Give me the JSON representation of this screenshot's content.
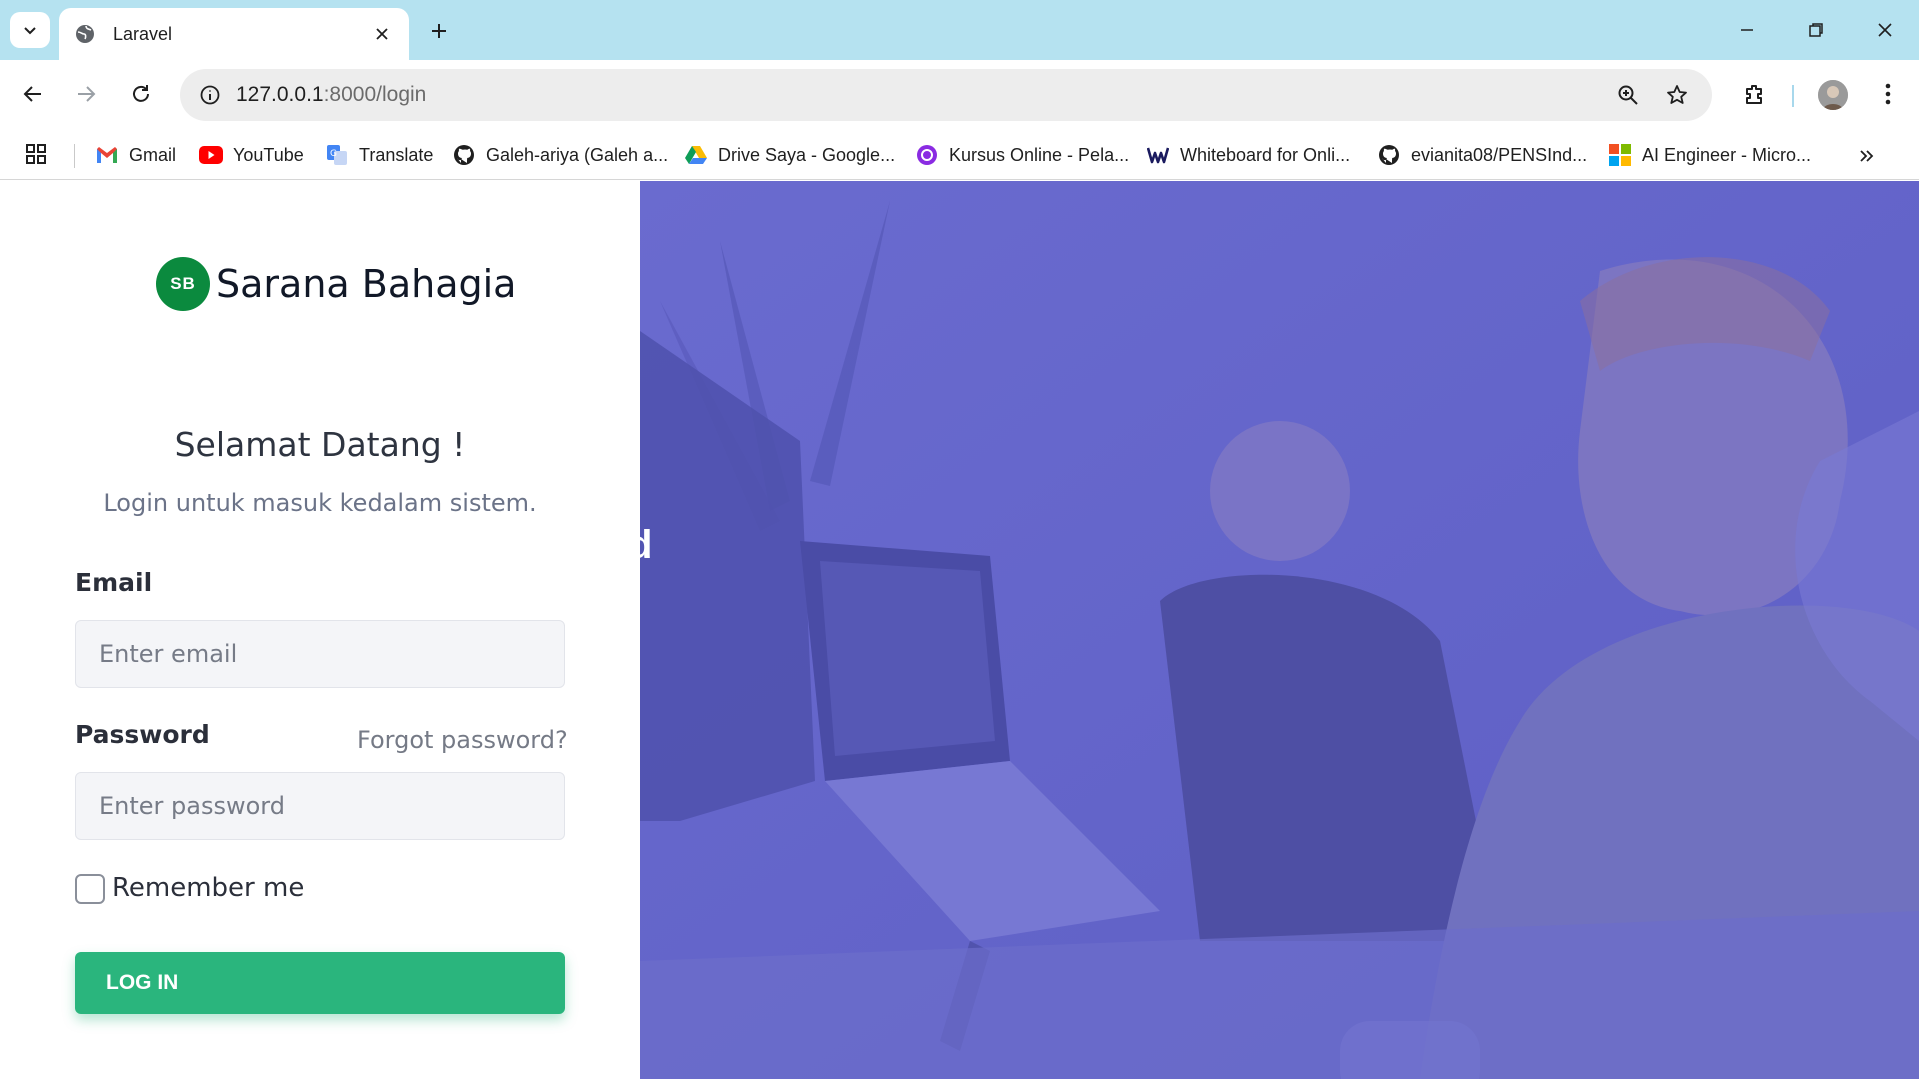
{
  "browser": {
    "tab_title": "Laravel",
    "url_host": "127.0.0.1",
    "url_rest": ":8000/login",
    "bookmarks": [
      {
        "label": "Gmail",
        "icon": "gmail-icon"
      },
      {
        "label": "YouTube",
        "icon": "youtube-icon"
      },
      {
        "label": "Translate",
        "icon": "translate-icon"
      },
      {
        "label": "Galeh-ariya (Galeh a...",
        "icon": "github-icon"
      },
      {
        "label": "Drive Saya - Google...",
        "icon": "drive-icon"
      },
      {
        "label": "Kursus Online - Pela...",
        "icon": "kursus-icon"
      },
      {
        "label": "Whiteboard for Onli...",
        "icon": "whiteboard-icon"
      },
      {
        "label": "evianita08/PENSInd...",
        "icon": "github-icon"
      },
      {
        "label": "AI Engineer - Micro...",
        "icon": "microsoft-icon"
      }
    ]
  },
  "brand": {
    "mark": "SB",
    "name": "Sarana Bahagia",
    "color": "#0b8a3e"
  },
  "login": {
    "title": "Selamat Datang !",
    "subtitle": "Login untuk masuk kedalam sistem.",
    "email_label": "Email",
    "email_placeholder": "Enter email",
    "password_label": "Password",
    "forgot_label": "Forgot password?",
    "password_placeholder": "Enter password",
    "remember_label": "Remember me",
    "button_label": "LOG IN",
    "button_color": "#2ab57d"
  },
  "hero": {
    "overlay_color": "#6364c8",
    "partial_text": "d"
  }
}
